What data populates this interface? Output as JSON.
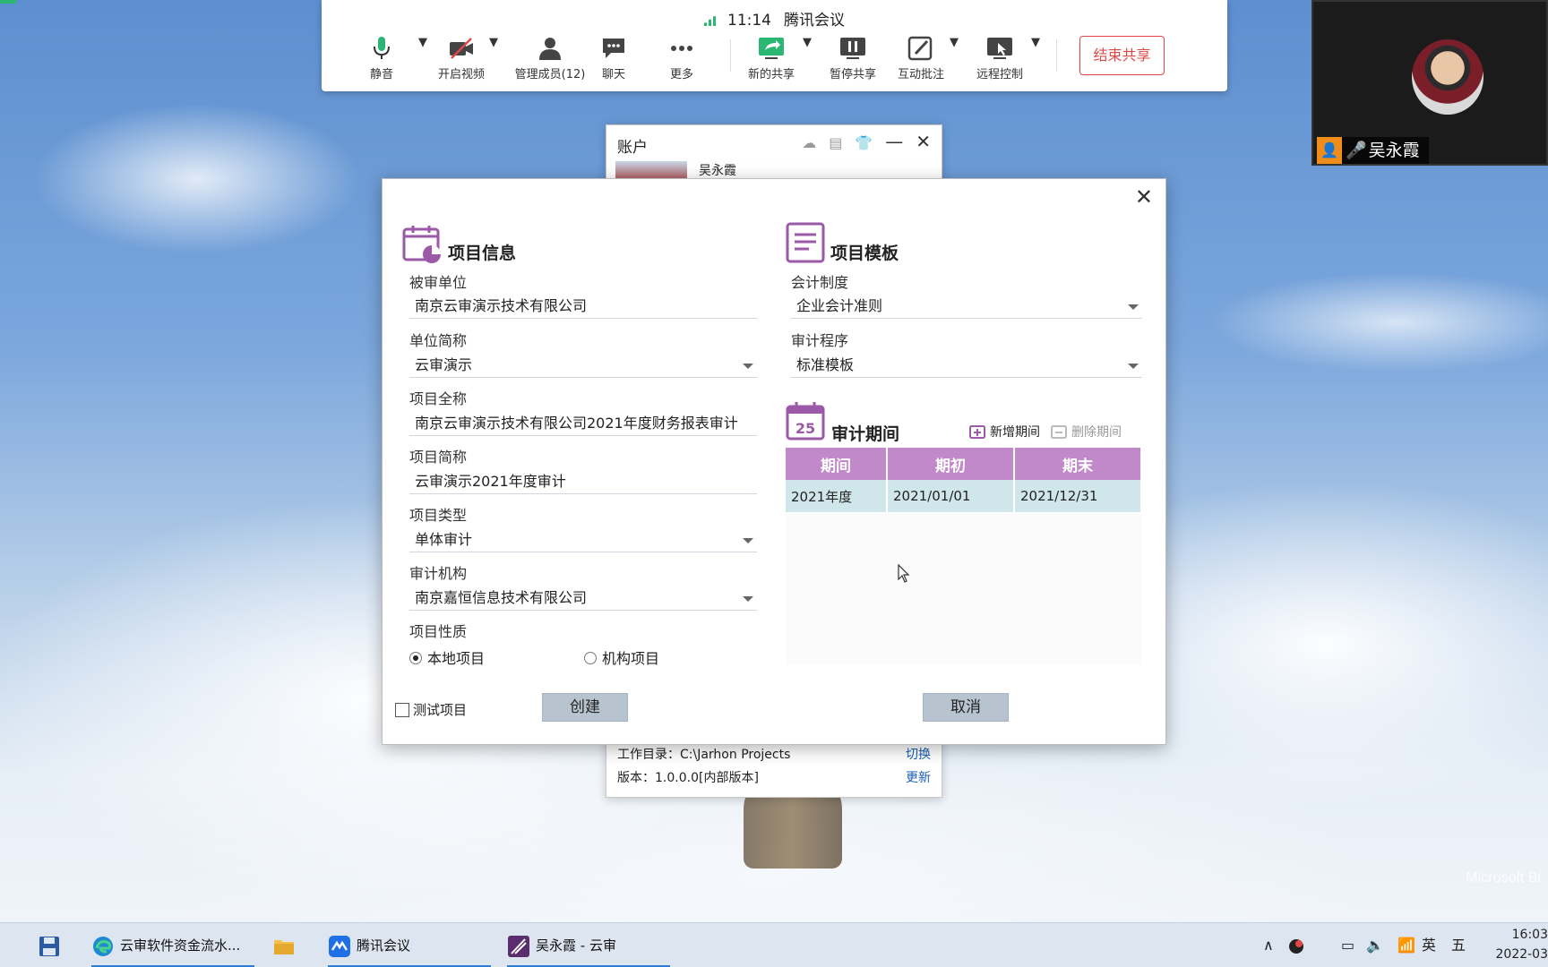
{
  "meeting": {
    "time": "11:14",
    "app_name": "腾讯会议",
    "tools": {
      "mute": "静音",
      "video": "开启视频",
      "members": "管理成员(12)",
      "chat": "聊天",
      "more": "更多",
      "new_share": "新的共享",
      "pause_share": "暂停共享",
      "annotate": "互动批注",
      "remote": "远程控制"
    },
    "end_share": "结束共享",
    "participant_name": "吴永霞"
  },
  "account_window": {
    "title": "账户",
    "user": "吴永霞",
    "workdir": "工作目录：C:\\Jarhon Projects",
    "workdir_link": "切换",
    "version": "版本：1.0.0.0[内部版本]",
    "version_link": "更新"
  },
  "dialog": {
    "project_info": {
      "title": "项目信息",
      "audited_unit_label": "被审单位",
      "audited_unit_value": "南京云审演示技术有限公司",
      "unit_abbr_label": "单位简称",
      "unit_abbr_value": "云审演示",
      "project_full_label": "项目全称",
      "project_full_value": "南京云审演示技术有限公司2021年度财务报表审计",
      "project_abbr_label": "项目简称",
      "project_abbr_value": "云审演示2021年度审计",
      "project_type_label": "项目类型",
      "project_type_value": "单体审计",
      "audit_org_label": "审计机构",
      "audit_org_value": "南京嘉恒信息技术有限公司",
      "nature_label": "项目性质",
      "nature_local": "本地项目",
      "nature_org": "机构项目",
      "nature_selected": "本地项目"
    },
    "template": {
      "title": "项目模板",
      "accounting_label": "会计制度",
      "accounting_value": "企业会计准则",
      "procedure_label": "审计程序",
      "procedure_value": "标准模板"
    },
    "periods": {
      "title": "审计期间",
      "calendar_day": "25",
      "add": "新增期间",
      "delete": "删除期间",
      "columns": [
        "期间",
        "期初",
        "期末"
      ],
      "rows": [
        [
          "2021年度",
          "2021/01/01",
          "2021/12/31"
        ]
      ]
    },
    "test_project": "测试项目",
    "create": "创建",
    "cancel": "取消"
  },
  "taskbar": {
    "items": [
      "云审软件资金流水...",
      "腾讯会议",
      "吴永霞 - 云审"
    ],
    "ime": "英",
    "ime_mode": "五",
    "clock_time": "16:03",
    "clock_date": "2022-03"
  },
  "watermark": "Microsoft Bi",
  "colors": {
    "accent_purple": "#c189c9",
    "row_teal": "#cfe6ea",
    "end_share_red": "#e04848"
  }
}
